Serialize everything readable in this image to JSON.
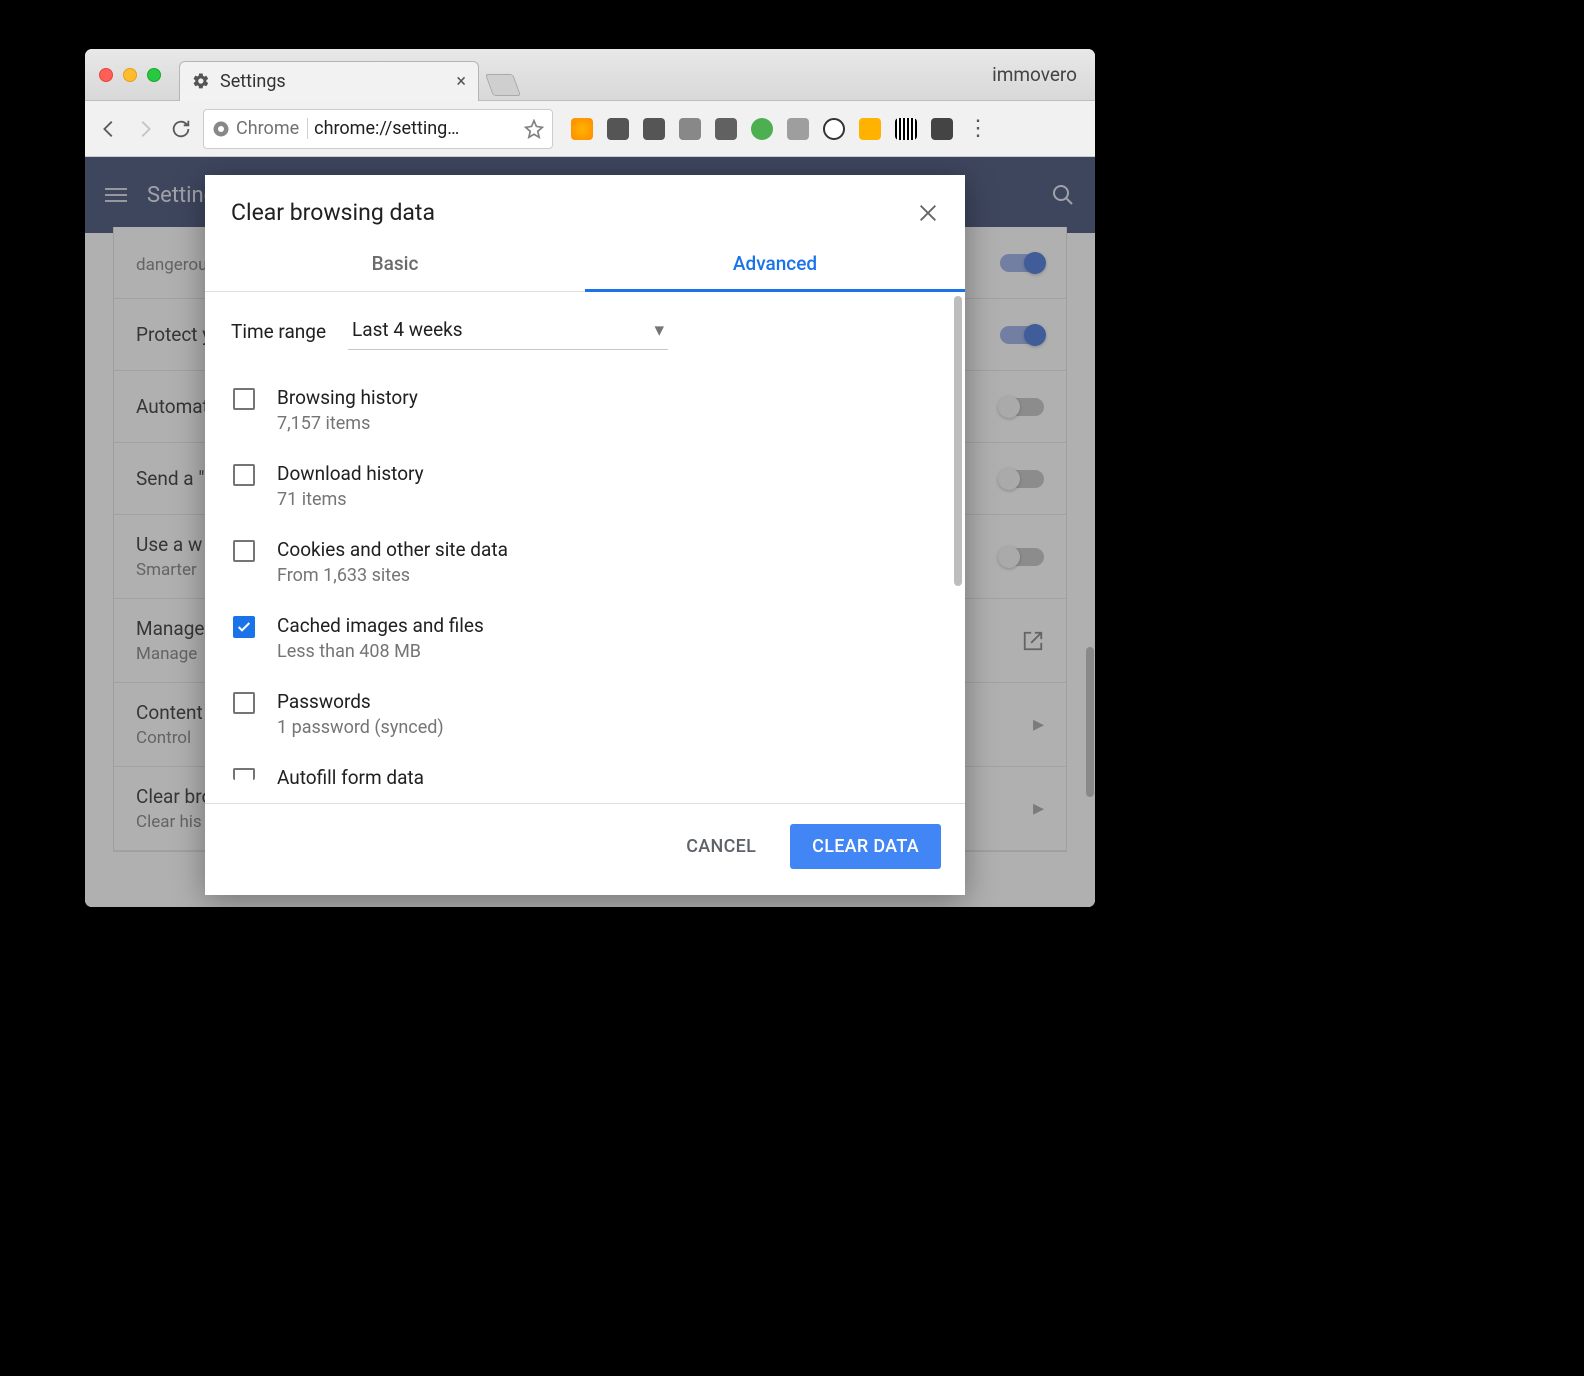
{
  "window": {
    "tab_title": "Settings",
    "profile": "immovero"
  },
  "omnibox": {
    "scheme_label": "Chrome",
    "url": "chrome://setting…"
  },
  "header": {
    "title": "Settings"
  },
  "settings_rows": [
    {
      "title": "",
      "sub": "dangerou",
      "toggle": true
    },
    {
      "title": "Protect y",
      "sub": "",
      "toggle": true
    },
    {
      "title": "Automat",
      "sub": "",
      "toggle": false
    },
    {
      "title": "Send a \"",
      "sub": "",
      "toggle": false
    },
    {
      "title": "Use a w",
      "sub": "Smarter",
      "toggle": false
    },
    {
      "title": "Manage",
      "sub": "Manage",
      "external": true
    },
    {
      "title": "Content",
      "sub": "Control",
      "chevron": true
    },
    {
      "title": "Clear bro",
      "sub": "Clear his",
      "chevron": true
    }
  ],
  "dialog": {
    "title": "Clear browsing data",
    "tabs": {
      "basic": "Basic",
      "advanced": "Advanced"
    },
    "time_range_label": "Time range",
    "time_range_value": "Last 4 weeks",
    "items": [
      {
        "title": "Browsing history",
        "sub": "7,157 items",
        "checked": false
      },
      {
        "title": "Download history",
        "sub": "71 items",
        "checked": false
      },
      {
        "title": "Cookies and other site data",
        "sub": "From 1,633 sites",
        "checked": false
      },
      {
        "title": "Cached images and files",
        "sub": "Less than 408 MB",
        "checked": true
      },
      {
        "title": "Passwords",
        "sub": "1 password (synced)",
        "checked": false
      },
      {
        "title": "Autofill form data",
        "sub": "",
        "checked": false
      }
    ],
    "cancel": "CANCEL",
    "clear": "CLEAR DATA"
  }
}
